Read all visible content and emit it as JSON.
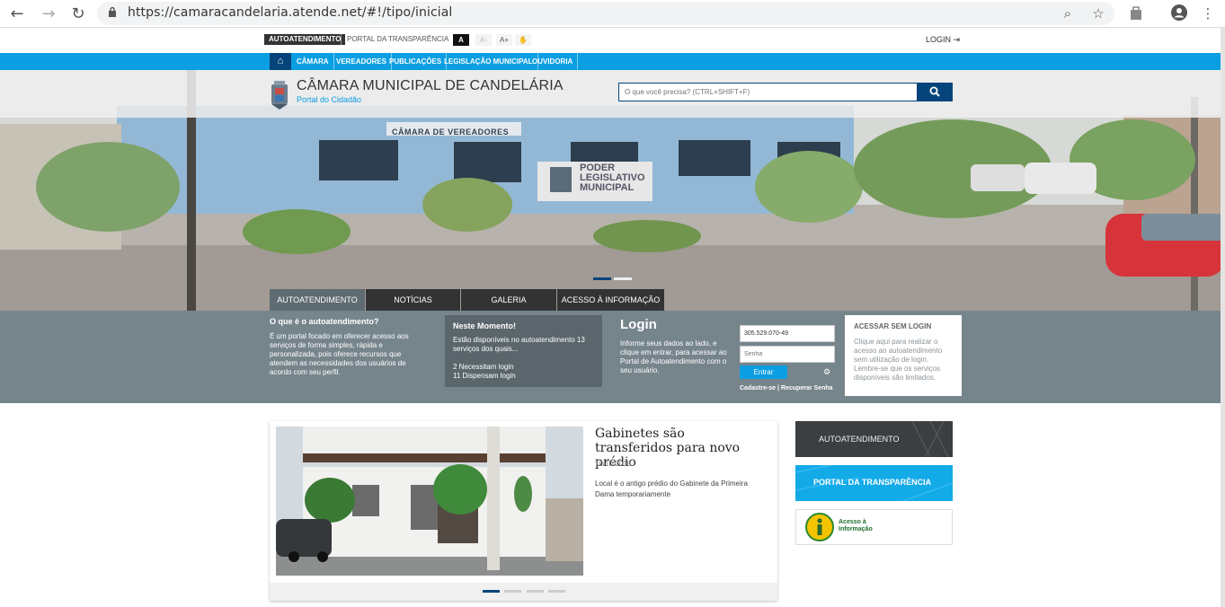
{
  "browser": {
    "url": "https://camaracandelaria.atende.net/#!/tipo/inicial",
    "back_icon": "arrow-left-icon",
    "forward_icon": "arrow-right-icon",
    "reload_icon": "reload-icon"
  },
  "topbar": {
    "autoatendimento": "AUTOATENDIMENTO",
    "portal_transparencia": "PORTAL DA TRANSPARÊNCIA",
    "font_contrast": "A",
    "font_decrease": "A-",
    "font_increase": "A+",
    "login": "LOGIN"
  },
  "nav": {
    "items": [
      "CÂMARA",
      "VEREADORES",
      "PUBLICAÇÕES",
      "LEGISLAÇÃO MUNICIPAL",
      "OUVIDORIA"
    ]
  },
  "header": {
    "title": "CÂMARA MUNICIPAL DE CANDELÁRIA",
    "subtitle": "Portal do Cidadão",
    "search_placeholder": "O que você precisa? (CTRL+SHIFT+F)"
  },
  "hero": {
    "sign_top": "CÂMARA DE VEREADORES",
    "sign_main": [
      "PODER",
      "LEGISLATIVO",
      "MUNICIPAL"
    ]
  },
  "tabs": [
    "AUTOATENDIMENTO",
    "NOTÍCIAS",
    "GALERIA",
    "ACESSO À INFORMAÇÃO"
  ],
  "panel": {
    "what_title": "O que é o autoatendimento?",
    "what_text": "É um portal focado em oferecer acesso aos serviços de forma simples, rápida e personalizada, pois oferece recursos que atendem as necessidades dos usuários de acordo com seu perfil.",
    "moment_title": "Neste Momento!",
    "moment_text": "Estão disponíveis no autoatendimento 13 serviços dos quais...",
    "moment_login": "2 Necessitam login",
    "moment_nologin": "11 Dispensam login",
    "login_title": "Login",
    "login_text": "Informe seus dados ao lado, e clique em entrar, para acessar ao Portal de Autoatendimento com o seu usuário.",
    "user_value": "305.529.070-49",
    "password_placeholder": "Senha",
    "enter_label": "Entrar",
    "register": "Cadastre-se",
    "recover": "Recuperar Senha",
    "nologin_title": "ACESSAR SEM LOGIN",
    "nologin_text": "Clique aqui para realizar o acesso ao autoatendimento sem utilização de login. Lembre-se que os serviços disponíveis são limitados."
  },
  "news": {
    "title": "Gabinetes são transferidos para novo prédio",
    "date": "10/10/2018",
    "description": "Local é o antigo prédio do Gabinete da Primeira Dama temporariamente"
  },
  "side": {
    "autoatendimento": "AUTOATENDIMENTO",
    "transparencia": "PORTAL DA TRANSPARÊNCIA",
    "acesso_line1": "Acesso à",
    "acesso_line2": "Informação"
  },
  "colors": {
    "brand_blue": "#0a9ee3",
    "dark_navy": "#04447a",
    "panel_gray": "#76858c",
    "dark": "#333333"
  }
}
